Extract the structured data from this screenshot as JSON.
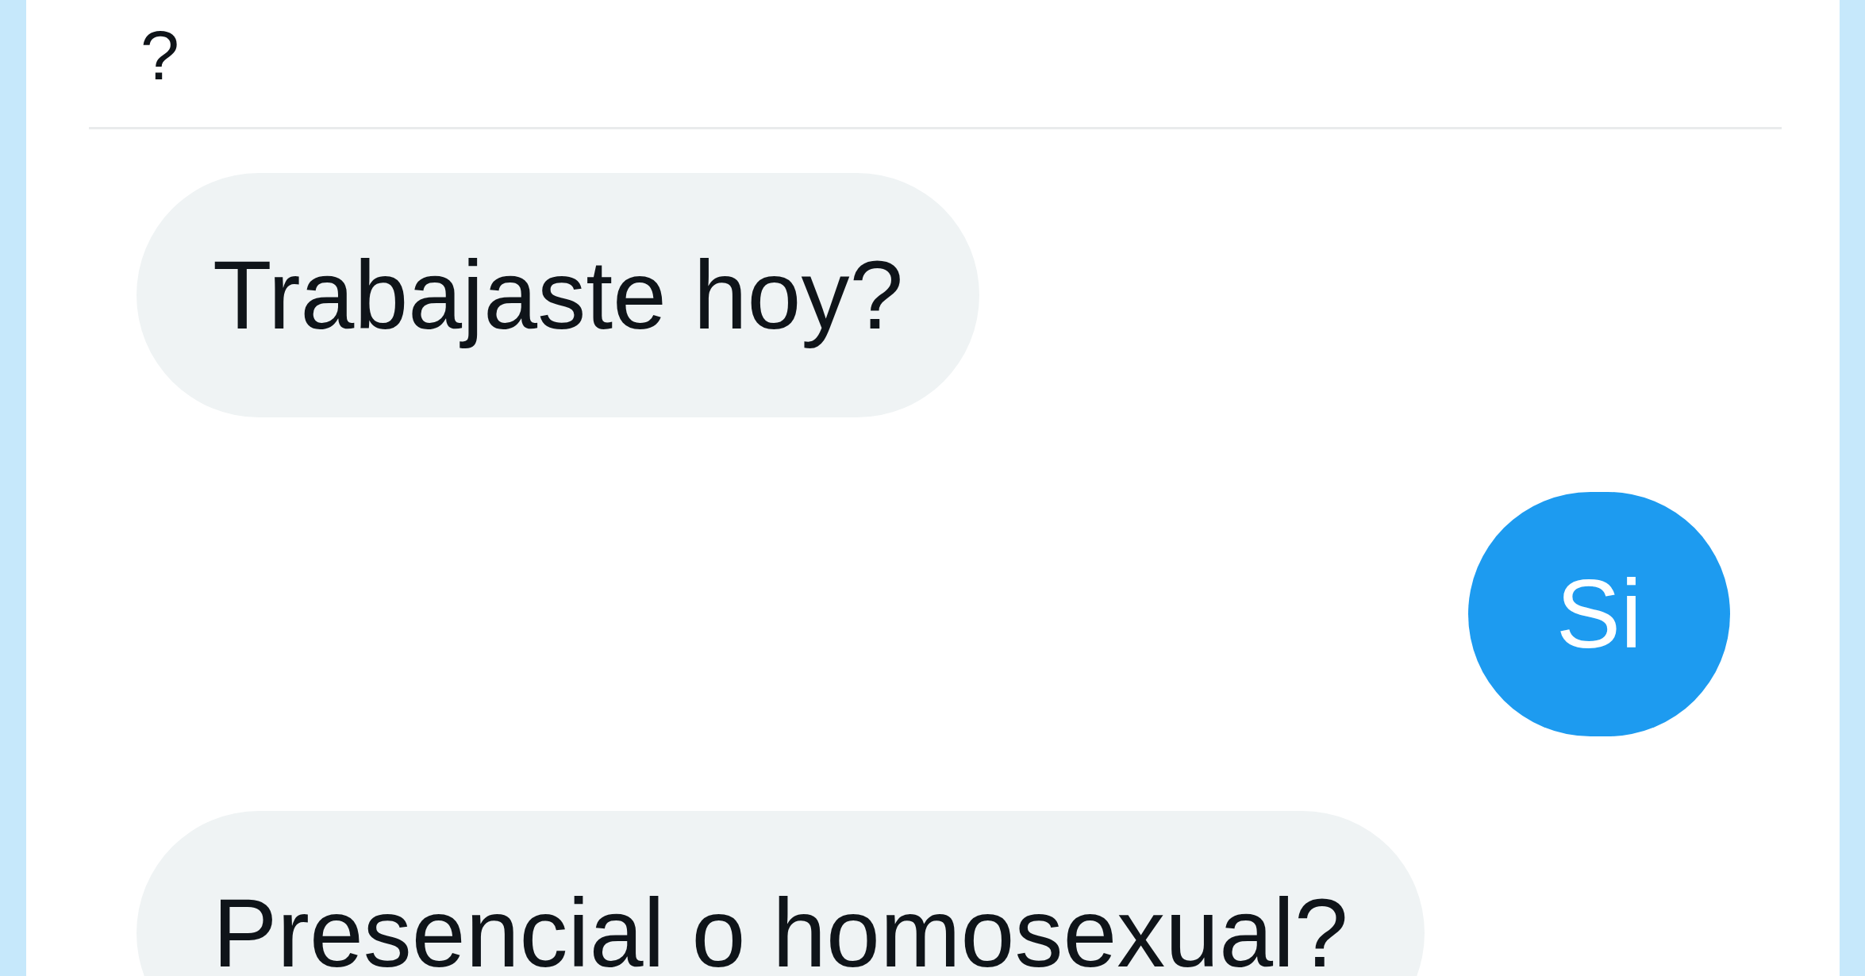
{
  "post": {
    "text": "?"
  },
  "messages": [
    {
      "kind": "incoming",
      "text": "Trabajaste hoy?"
    },
    {
      "kind": "outgoing",
      "text": "Si"
    },
    {
      "kind": "incoming",
      "text": "Presencial o homosexual?"
    }
  ]
}
